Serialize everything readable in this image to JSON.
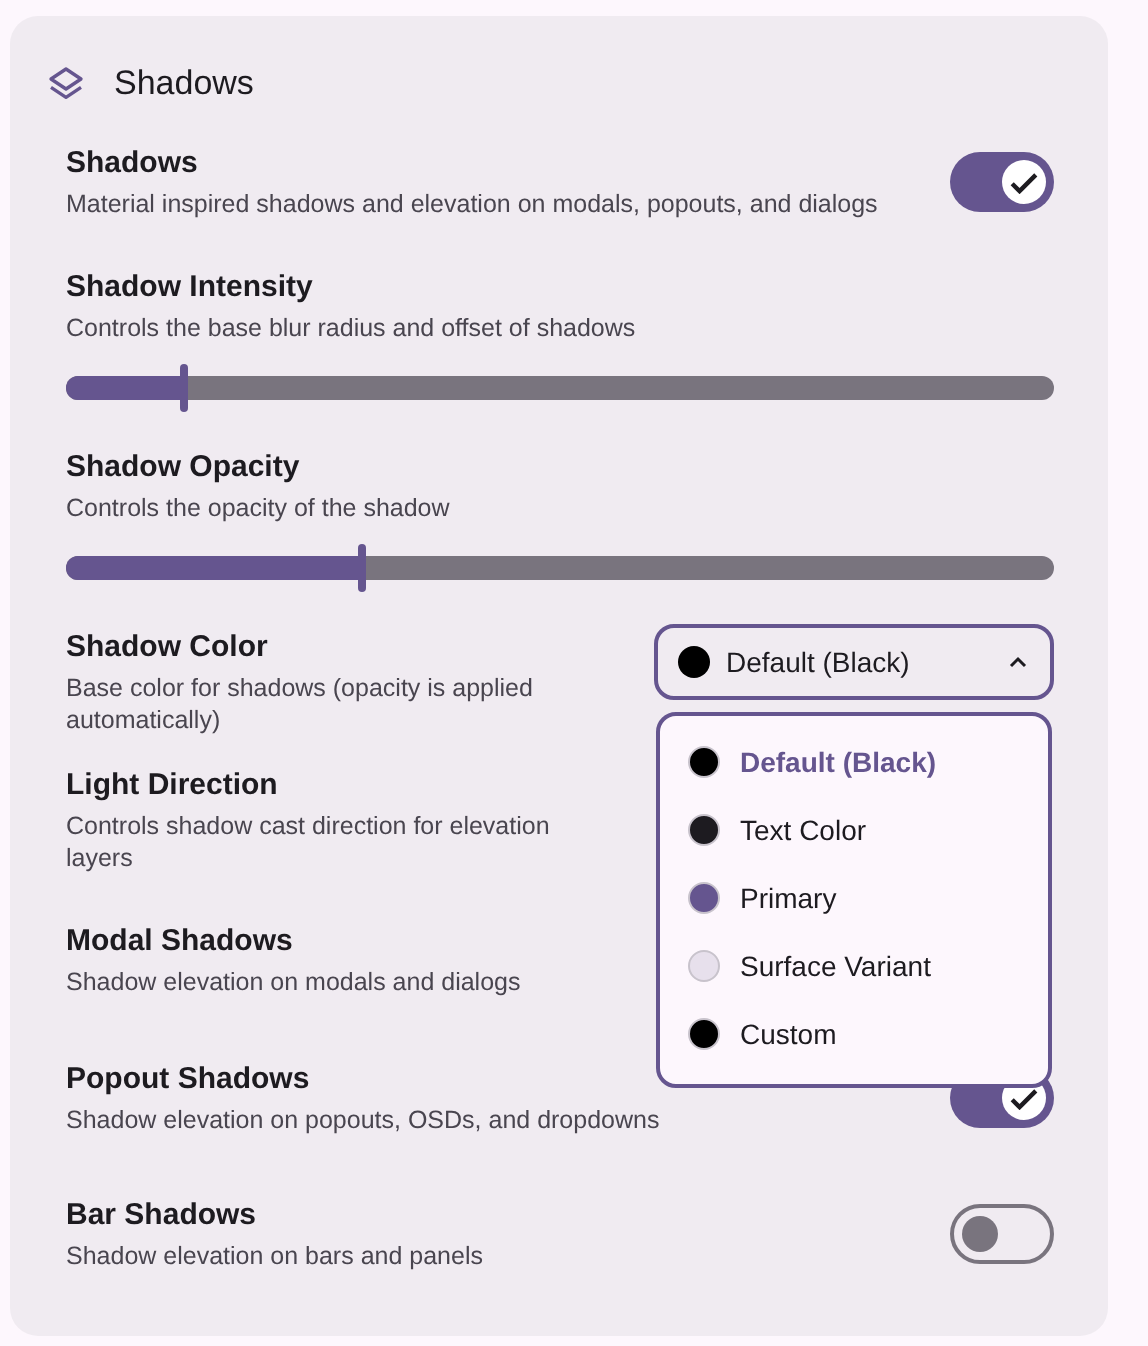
{
  "section": {
    "title": "Shadows"
  },
  "settings": [
    {
      "kind": "toggle",
      "title": "Shadows",
      "description": "Material inspired shadows and elevation on modals, popouts, and dialogs",
      "on": true
    },
    {
      "kind": "slider",
      "title": "Shadow Intensity",
      "description": "Controls the base blur radius and offset of shadows",
      "level": 0.12
    },
    {
      "kind": "slider",
      "title": "Shadow Opacity",
      "description": "Controls the opacity of the shadow",
      "level": 0.3
    },
    {
      "kind": "select",
      "title": "Shadow Color",
      "description": "Base color for shadows (opacity is applied automatically)",
      "value": "Default (Black)",
      "color": "#000000",
      "expanded": true,
      "options": [
        {
          "label": "Default (Black)",
          "color": "#000000",
          "selected": true
        },
        {
          "label": "Text Color",
          "color": "#1d1b20",
          "selected": false
        },
        {
          "label": "Primary",
          "color": "#65558f",
          "selected": false
        },
        {
          "label": "Surface Variant",
          "color": "#e7e0ec",
          "selected": false
        },
        {
          "label": "Custom",
          "color": "#000000",
          "selected": false
        }
      ]
    },
    {
      "kind": "hidden",
      "title": "Light Direction",
      "description": "Controls shadow cast direction for elevation layers"
    },
    {
      "kind": "hidden",
      "title": "Modal Shadows",
      "description": "Shadow elevation on modals and dialogs"
    },
    {
      "kind": "toggle",
      "title": "Popout Shadows",
      "description": "Shadow elevation on popouts, OSDs, and dropdowns",
      "on": true
    },
    {
      "kind": "toggle",
      "title": "Bar Shadows",
      "description": "Shadow elevation on bars and panels",
      "on": false
    }
  ]
}
